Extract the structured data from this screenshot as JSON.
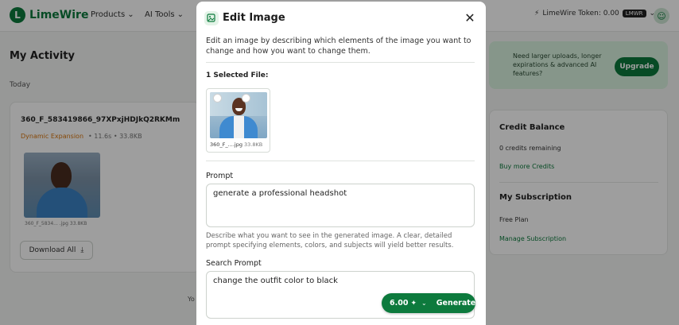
{
  "app": {
    "logo_text": "LimeWire",
    "nav": [
      {
        "label": "Products"
      },
      {
        "label": "AI Tools"
      }
    ],
    "token_label": "LimeWire Token: 0.00",
    "token_badge": "LMWR",
    "activity_title": "My Activity",
    "today_label": "Today",
    "file_card": {
      "name": "360_F_583419866_97XPxjHDJkQ2RKMm",
      "tag": "Dynamic Expansion",
      "meta": "• 11.6s • 33.8KB",
      "thumb_caption": "360_F_5834... .jpg  33.8KB",
      "download_label": "Download All"
    },
    "upgrade": {
      "text": "Need larger uploads, longer expirations & advanced AI features?",
      "button_label": "Upgrade"
    },
    "side": {
      "credit_title": "Credit Balance",
      "credit_text": "0 credits remaining",
      "credit_link": "Buy more Credits",
      "sub_title": "My Subscription",
      "sub_plan": "Free Plan",
      "sub_link": "Manage Subscription"
    },
    "bottom_stub": "Yo"
  },
  "modal": {
    "title": "Edit Image",
    "close_glyph": "✕",
    "description": "Edit an image by describing which elements of the image you want to change and how you want to change them.",
    "selected_label": "1 Selected File:",
    "file": {
      "name": "360_F_....jpg",
      "size": "33.8KB"
    },
    "prompt_label": "Prompt",
    "prompt_value": "generate a professional headshot",
    "prompt_hint": "Describe what you want to see in the generated image. A clear, detailed prompt specifying elements, colors, and subjects will yield better results.",
    "search_label": "Search Prompt",
    "search_value": "change the outfit color to black",
    "generate": {
      "cost": "6.00",
      "sparkle": "✦",
      "chevron": "⌄",
      "label": "Generate"
    }
  },
  "colors": {
    "brand_green": "#0d7a3d",
    "overlay": "rgba(0,0,0,0.38)"
  }
}
